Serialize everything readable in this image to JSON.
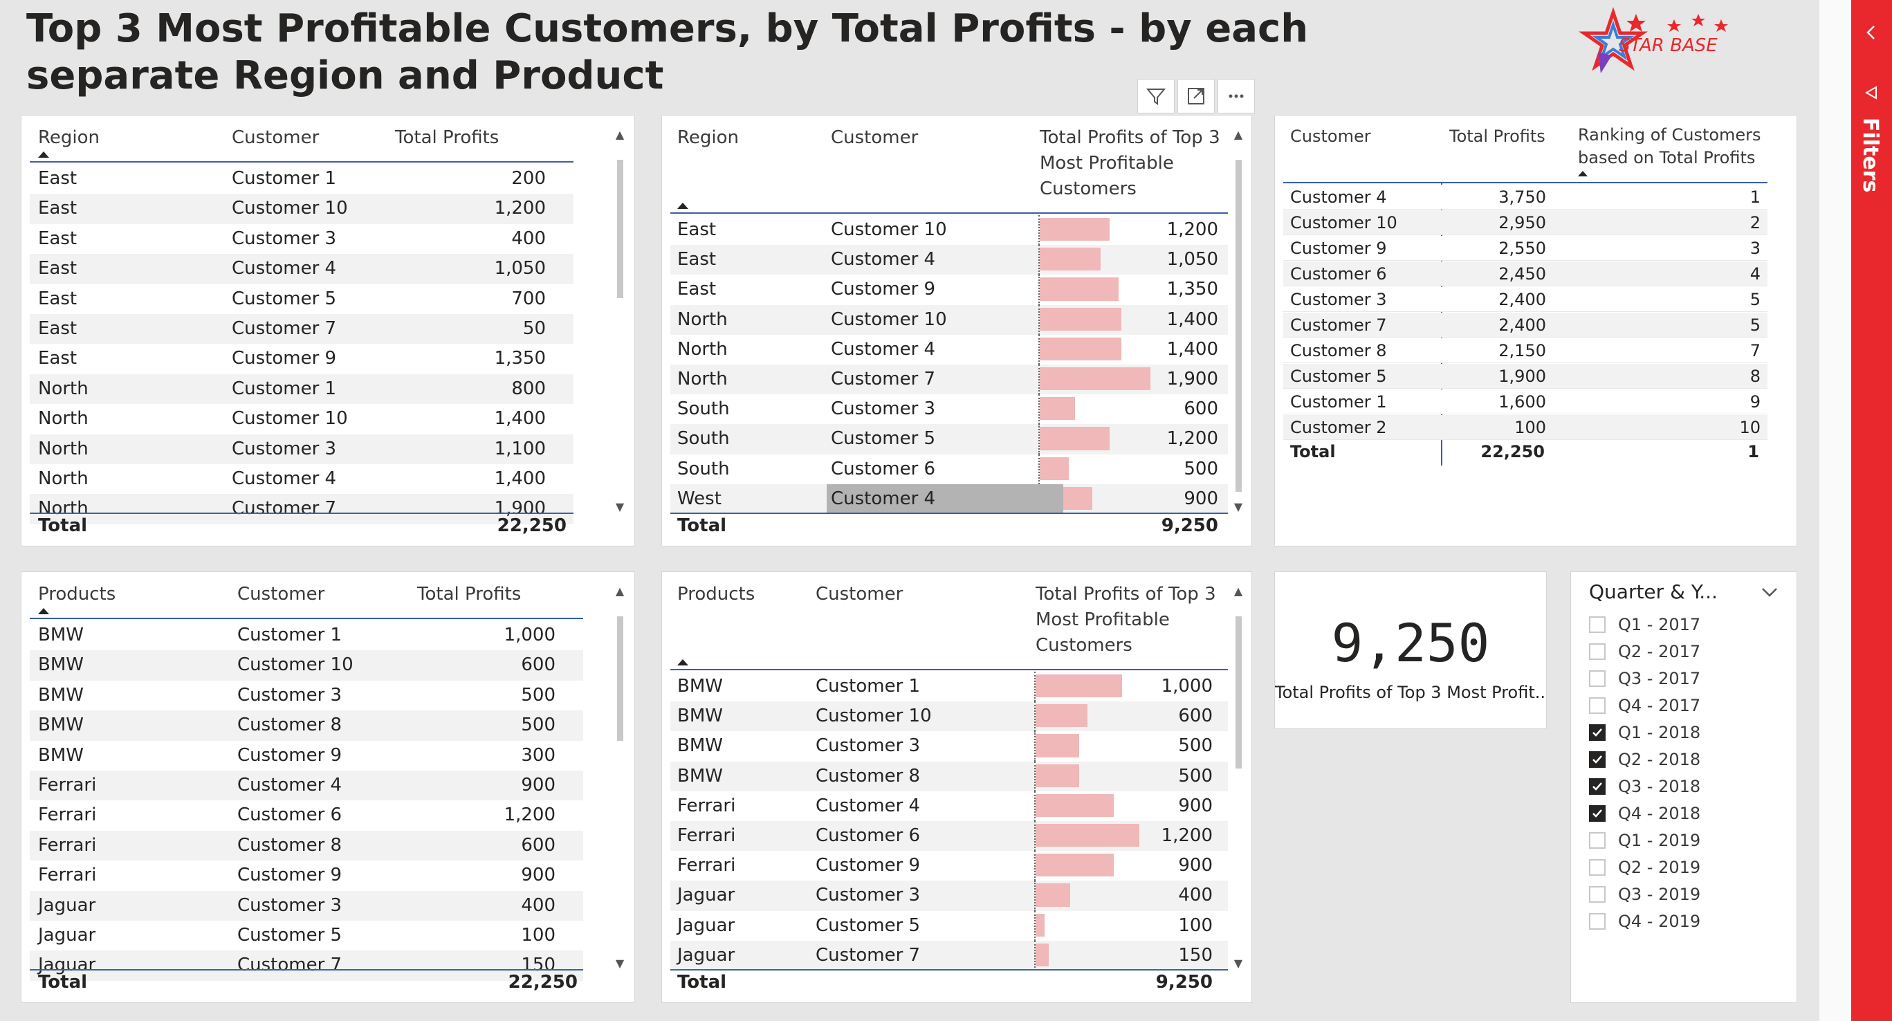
{
  "title": "Top 3 Most Profitable Customers, by Total Profits - by each separate Region and Product",
  "logo_text": "STAR BASE",
  "colors": {
    "accent": "#e8282c",
    "bar": "#f0b8b8",
    "header_line": "#3b5fa8",
    "row_alt": "#f2f2f2",
    "selected": "#b3b3b3"
  },
  "visual_header_icons": [
    "filter-icon",
    "focus-mode-icon",
    "more-options-icon"
  ],
  "region_table": {
    "headers": [
      "Region",
      "Customer",
      "Total Profits"
    ],
    "rows": [
      [
        "East",
        "Customer 1",
        "200"
      ],
      [
        "East",
        "Customer 10",
        "1,200"
      ],
      [
        "East",
        "Customer 3",
        "400"
      ],
      [
        "East",
        "Customer 4",
        "1,050"
      ],
      [
        "East",
        "Customer 5",
        "700"
      ],
      [
        "East",
        "Customer 7",
        "50"
      ],
      [
        "East",
        "Customer 9",
        "1,350"
      ],
      [
        "North",
        "Customer 1",
        "800"
      ],
      [
        "North",
        "Customer 10",
        "1,400"
      ],
      [
        "North",
        "Customer 3",
        "1,100"
      ],
      [
        "North",
        "Customer 4",
        "1,400"
      ],
      [
        "North",
        "Customer 7",
        "1,900"
      ]
    ],
    "total_label": "Total",
    "total_value": "22,250"
  },
  "region_top3_table": {
    "headers": [
      "Region",
      "Customer",
      "Total Profits of Top 3 Most Profitable Customers"
    ],
    "rows": [
      [
        "East",
        "Customer 10",
        "1,200",
        1200
      ],
      [
        "East",
        "Customer 4",
        "1,050",
        1050
      ],
      [
        "East",
        "Customer 9",
        "1,350",
        1350
      ],
      [
        "North",
        "Customer 10",
        "1,400",
        1400
      ],
      [
        "North",
        "Customer 4",
        "1,400",
        1400
      ],
      [
        "North",
        "Customer 7",
        "1,900",
        1900
      ],
      [
        "South",
        "Customer 3",
        "600",
        600
      ],
      [
        "South",
        "Customer 5",
        "1,200",
        1200
      ],
      [
        "South",
        "Customer 6",
        "500",
        500
      ],
      [
        "West",
        "Customer 4",
        "900",
        900
      ]
    ],
    "total_label": "Total",
    "total_value": "9,250"
  },
  "ranking_table": {
    "headers": [
      "Customer",
      "Total Profits",
      "Ranking of Customers based on Total Profits"
    ],
    "rows": [
      [
        "Customer 4",
        "3,750",
        "1"
      ],
      [
        "Customer 10",
        "2,950",
        "2"
      ],
      [
        "Customer 9",
        "2,550",
        "3"
      ],
      [
        "Customer 6",
        "2,450",
        "4"
      ],
      [
        "Customer 3",
        "2,400",
        "5"
      ],
      [
        "Customer 7",
        "2,400",
        "5"
      ],
      [
        "Customer 8",
        "2,150",
        "7"
      ],
      [
        "Customer 5",
        "1,900",
        "8"
      ],
      [
        "Customer 1",
        "1,600",
        "9"
      ],
      [
        "Customer 2",
        "100",
        "10"
      ]
    ],
    "total_label": "Total",
    "total_value": "22,250",
    "total_rank": "1"
  },
  "product_table": {
    "headers": [
      "Products",
      "Customer",
      "Total Profits"
    ],
    "rows": [
      [
        "BMW",
        "Customer 1",
        "1,000"
      ],
      [
        "BMW",
        "Customer 10",
        "600"
      ],
      [
        "BMW",
        "Customer 3",
        "500"
      ],
      [
        "BMW",
        "Customer 8",
        "500"
      ],
      [
        "BMW",
        "Customer 9",
        "300"
      ],
      [
        "Ferrari",
        "Customer 4",
        "900"
      ],
      [
        "Ferrari",
        "Customer 6",
        "1,200"
      ],
      [
        "Ferrari",
        "Customer 8",
        "600"
      ],
      [
        "Ferrari",
        "Customer 9",
        "900"
      ],
      [
        "Jaguar",
        "Customer 3",
        "400"
      ],
      [
        "Jaguar",
        "Customer 5",
        "100"
      ],
      [
        "Jaguar",
        "Customer 7",
        "150"
      ]
    ],
    "total_label": "Total",
    "total_value": "22,250"
  },
  "product_top3_table": {
    "headers": [
      "Products",
      "Customer",
      "Total Profits of Top 3 Most Profitable Customers"
    ],
    "rows": [
      [
        "BMW",
        "Customer 1",
        "1,000",
        1000
      ],
      [
        "BMW",
        "Customer 10",
        "600",
        600
      ],
      [
        "BMW",
        "Customer 3",
        "500",
        500
      ],
      [
        "BMW",
        "Customer 8",
        "500",
        500
      ],
      [
        "Ferrari",
        "Customer 4",
        "900",
        900
      ],
      [
        "Ferrari",
        "Customer 6",
        "1,200",
        1200
      ],
      [
        "Ferrari",
        "Customer 9",
        "900",
        900
      ],
      [
        "Jaguar",
        "Customer 3",
        "400",
        400
      ],
      [
        "Jaguar",
        "Customer 5",
        "100",
        100
      ],
      [
        "Jaguar",
        "Customer 7",
        "150",
        150
      ]
    ],
    "total_label": "Total",
    "total_value": "9,250"
  },
  "card": {
    "value": "9,250",
    "label": "Total Profits of Top 3 Most Profit..."
  },
  "slicer": {
    "title": "Quarter & Y...",
    "items": [
      {
        "label": "Q1 - 2017",
        "checked": false
      },
      {
        "label": "Q2 - 2017",
        "checked": false
      },
      {
        "label": "Q3 - 2017",
        "checked": false
      },
      {
        "label": "Q4 - 2017",
        "checked": false
      },
      {
        "label": "Q1 - 2018",
        "checked": true
      },
      {
        "label": "Q2 - 2018",
        "checked": true
      },
      {
        "label": "Q3 - 2018",
        "checked": true
      },
      {
        "label": "Q4 - 2018",
        "checked": true
      },
      {
        "label": "Q1 - 2019",
        "checked": false
      },
      {
        "label": "Q2 - 2019",
        "checked": false
      },
      {
        "label": "Q3 - 2019",
        "checked": false
      },
      {
        "label": "Q4 - 2019",
        "checked": false
      }
    ]
  },
  "filters_pane": {
    "label": "Filters"
  }
}
